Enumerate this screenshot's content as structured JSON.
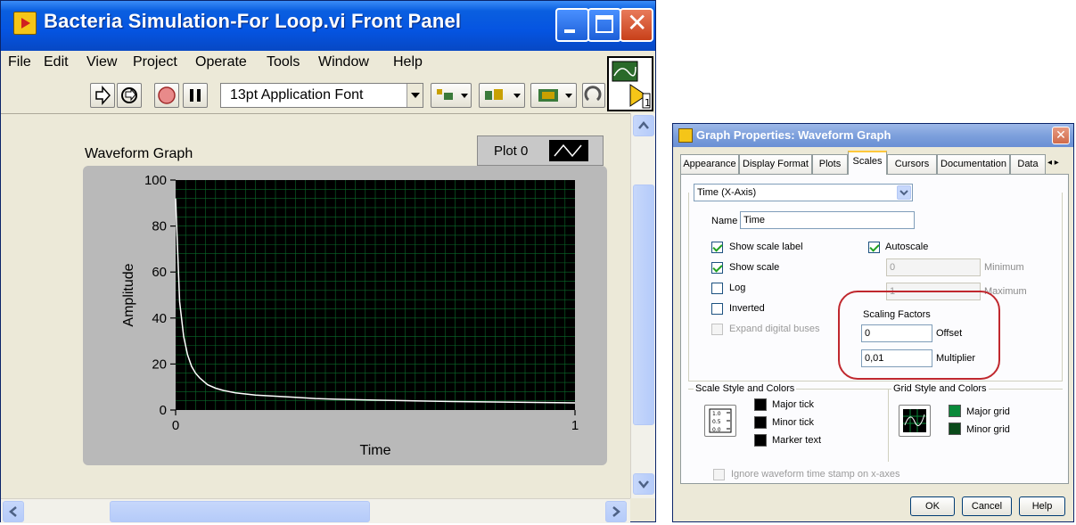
{
  "front_panel": {
    "title": "Bacteria Simulation-For Loop.vi Front Panel",
    "menu": [
      "File",
      "Edit",
      "View",
      "Project",
      "Operate",
      "Tools",
      "Window",
      "Help"
    ],
    "toolbar": {
      "font": "13pt Application Font"
    },
    "graph": {
      "label": "Waveform Graph",
      "legend_plot": "Plot 0",
      "xlabel": "Time",
      "ylabel": "Amplitude",
      "y_ticks": [
        "100",
        "80",
        "60",
        "40",
        "20",
        "0"
      ],
      "x_ticks": [
        "0",
        "1"
      ]
    }
  },
  "chart_data": {
    "type": "line",
    "xlabel": "Time",
    "ylabel": "Amplitude",
    "xlim": [
      0,
      1
    ],
    "ylim": [
      0,
      100
    ],
    "grid": true,
    "legend": "top-right",
    "series": [
      {
        "name": "Plot 0",
        "color": "#ffffff",
        "x": [
          0,
          0.01,
          0.02,
          0.03,
          0.04,
          0.05,
          0.06,
          0.08,
          0.1,
          0.12,
          0.15,
          0.2,
          0.25,
          0.3,
          0.35,
          0.4,
          0.5,
          0.6,
          0.7,
          0.8,
          0.9,
          1.0
        ],
        "y": [
          92,
          47,
          32,
          24,
          19,
          16,
          14,
          11,
          9.5,
          8.5,
          7.5,
          6.5,
          6,
          5.5,
          5,
          4.7,
          4.3,
          4,
          3.7,
          3.5,
          3.3,
          3.1
        ]
      }
    ]
  },
  "dialog": {
    "title": "Graph Properties: Waveform Graph",
    "tabs": [
      "Appearance",
      "Display Format",
      "Plots",
      "Scales",
      "Cursors",
      "Documentation",
      "Data"
    ],
    "active_tab": "Scales",
    "axis_select": "Time (X-Axis)",
    "name_label": "Name",
    "name_value": "Time",
    "show_scale_label": "Show scale label",
    "show_scale": "Show scale",
    "log": "Log",
    "inverted": "Inverted",
    "expand_digital": "Expand digital buses",
    "autoscale": "Autoscale",
    "minimum_value": "0",
    "minimum_label": "Minimum",
    "maximum_value": "1",
    "maximum_label": "Maximum",
    "scaling_factors": "Scaling Factors",
    "offset_value": "0",
    "offset_label": "Offset",
    "multiplier_value": "0,01",
    "multiplier_label": "Multiplier",
    "scale_style_group": "Scale Style and Colors",
    "major_tick": "Major tick",
    "minor_tick": "Minor tick",
    "marker_text": "Marker text",
    "grid_style_group": "Grid Style and Colors",
    "major_grid": "Major grid",
    "minor_grid": "Minor grid",
    "ignore_timestamp": "Ignore waveform time stamp on x-axes",
    "ok": "OK",
    "cancel": "Cancel",
    "help": "Help",
    "colors": {
      "highlight_ring": "#c0282e",
      "grid_green": "#0a8a3a",
      "plot_bg": "#000000"
    }
  }
}
